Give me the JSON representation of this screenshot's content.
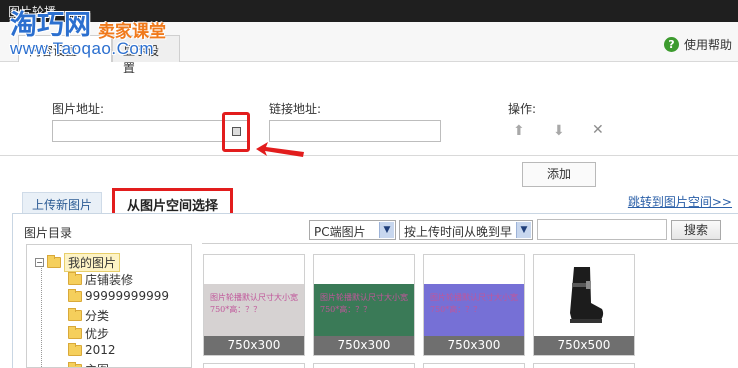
{
  "window": {
    "title": "图片轮播"
  },
  "watermark": {
    "logo": "淘巧网",
    "sub": "卖家课堂",
    "url": "www.Taoqao.Com"
  },
  "top_tabs": [
    {
      "label": "内容设置"
    },
    {
      "label": "显示设置"
    }
  ],
  "help": {
    "label": "使用帮助"
  },
  "form": {
    "image_url_label": "图片地址:",
    "image_url_value": "",
    "link_url_label": "链接地址:",
    "link_url_value": "",
    "actions_label": "操作:",
    "add_button": "添加"
  },
  "source_tabs": {
    "upload": "上传新图片",
    "space": "从图片空间选择"
  },
  "jump_link": "跳转到图片空间>>",
  "browser": {
    "dir_label": "图片目录",
    "platform_select": "PC端图片",
    "sort_select": "按上传时间从晚到早",
    "search_value": "",
    "search_button": "搜索"
  },
  "tree": {
    "root": "我的图片",
    "folders": [
      "店铺装修",
      "99999999999",
      "分类",
      "优步",
      "2012",
      "主图"
    ]
  },
  "thumbnails": [
    {
      "size": "750x300",
      "text": "图片轮播默认尺寸大小宽750*高：？？",
      "bg": "#d6d2d2",
      "fg": "#c0569a"
    },
    {
      "size": "750x300",
      "text": "图片轮播默认尺寸大小宽750*高：？？",
      "bg": "#3a7a57",
      "fg": "#c0569a"
    },
    {
      "size": "750x300",
      "text": "图片轮播默认尺寸大小宽750*高：？？",
      "bg": "#7670d6",
      "fg": "#c0569a"
    },
    {
      "size": "750x500",
      "text": "",
      "bg": "#ffffff",
      "fg": "#c0569a"
    }
  ],
  "colors": {
    "highlight_red": "#e21d1d",
    "link_blue": "#2a5fa8",
    "help_green": "#3d9b2f"
  },
  "icons": [
    "help-icon",
    "image-picker-icon",
    "arrow-up-icon",
    "arrow-down-icon",
    "delete-icon",
    "folder-icon"
  ]
}
